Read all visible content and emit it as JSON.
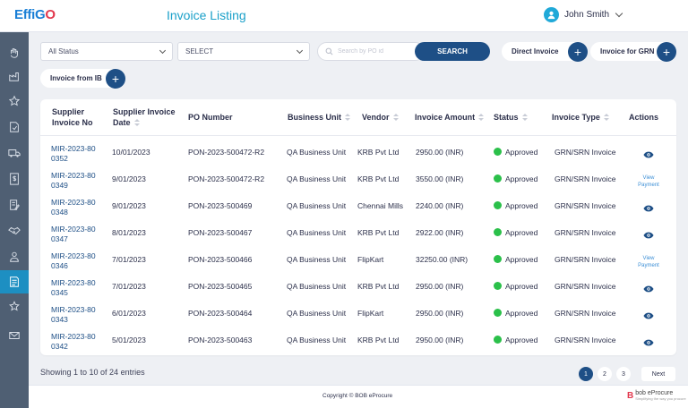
{
  "header": {
    "logo_main": "Effi",
    "logo_go": "G",
    "logo_o": "O",
    "title": "Invoice Listing",
    "user_name": "John Smith"
  },
  "sidebar": {
    "items": [
      {
        "icon": "hand-icon"
      },
      {
        "icon": "factory-icon"
      },
      {
        "icon": "star-icon"
      },
      {
        "icon": "document-check-icon"
      },
      {
        "icon": "truck-icon"
      },
      {
        "icon": "invoice-dollar-icon"
      },
      {
        "icon": "document-edit-icon"
      },
      {
        "icon": "handshake-icon"
      },
      {
        "icon": "user-badge-icon"
      },
      {
        "icon": "invoice-list-icon",
        "active": true
      },
      {
        "icon": "star-settings-icon"
      },
      {
        "icon": "mail-icon"
      }
    ]
  },
  "filters": {
    "status_value": "All Status",
    "select_value": "SELECT",
    "search_placeholder": "Search by PO id",
    "search_button": "SEARCH",
    "direct_invoice": "Direct Invoice",
    "invoice_for_grn": "Invoice for GRN",
    "invoice_from_ib": "Invoice from IB"
  },
  "table": {
    "headers": {
      "supplier_invoice_no_1": "Supplier",
      "supplier_invoice_no_2": "Invoice No",
      "supplier_invoice_date_1": "Supplier Invoice",
      "supplier_invoice_date_2": "Date",
      "po_number": "PO Number",
      "business_unit": "Business Unit",
      "vendor": "Vendor",
      "invoice_amount": "Invoice Amount",
      "status": "Status",
      "invoice_type": "Invoice Type",
      "actions": "Actions"
    },
    "rows": [
      {
        "inv1": "MIR-2023-80",
        "inv2": "0352",
        "date": "10/01/2023",
        "po": "PON-2023-500472-R2",
        "bu": "QA Business Unit",
        "vendor": "KRB Pvt Ltd",
        "amount": "2950.00 (INR)",
        "status": "Approved",
        "type": "GRN/SRN Invoice",
        "action": "view",
        "action_l1": "",
        "action_l2": ""
      },
      {
        "inv1": "MIR-2023-80",
        "inv2": "0349",
        "date": "9/01/2023",
        "po": "PON-2023-500472-R2",
        "bu": "QA Business Unit",
        "vendor": "KRB Pvt Ltd",
        "amount": "3550.00 (INR)",
        "status": "Approved",
        "type": "GRN/SRN Invoice",
        "action": "payment",
        "action_l1": "View",
        "action_l2": "Payment"
      },
      {
        "inv1": "MIR-2023-80",
        "inv2": "0348",
        "date": "9/01/2023",
        "po": "PON-2023-500469",
        "bu": "QA Business Unit",
        "vendor": "Chennai Mills",
        "amount": "2240.00 (INR)",
        "status": "Approved",
        "type": "GRN/SRN Invoice",
        "action": "view",
        "action_l1": "",
        "action_l2": ""
      },
      {
        "inv1": "MIR-2023-80",
        "inv2": "0347",
        "date": "8/01/2023",
        "po": "PON-2023-500467",
        "bu": "QA Business Unit",
        "vendor": "KRB Pvt Ltd",
        "amount": "2922.00 (INR)",
        "status": "Approved",
        "type": "GRN/SRN Invoice",
        "action": "view",
        "action_l1": "",
        "action_l2": ""
      },
      {
        "inv1": "MIR-2023-80",
        "inv2": "0346",
        "date": "7/01/2023",
        "po": "PON-2023-500466",
        "bu": "QA Business Unit",
        "vendor": "FlipKart",
        "amount": "32250.00 (INR)",
        "status": "Approved",
        "type": "GRN/SRN Invoice",
        "action": "payment",
        "action_l1": "View",
        "action_l2": "Payment"
      },
      {
        "inv1": "MIR-2023-80",
        "inv2": "0345",
        "date": "7/01/2023",
        "po": "PON-2023-500465",
        "bu": "QA Business Unit",
        "vendor": "KRB Pvt Ltd",
        "amount": "2950.00 (INR)",
        "status": "Approved",
        "type": "GRN/SRN Invoice",
        "action": "view",
        "action_l1": "",
        "action_l2": ""
      },
      {
        "inv1": "MIR-2023-80",
        "inv2": "0343",
        "date": "6/01/2023",
        "po": "PON-2023-500464",
        "bu": "QA Business Unit",
        "vendor": "FlipKart",
        "amount": "2950.00 (INR)",
        "status": "Approved",
        "type": "GRN/SRN Invoice",
        "action": "view",
        "action_l1": "",
        "action_l2": ""
      },
      {
        "inv1": "MIR-2023-80",
        "inv2": "0342",
        "date": "5/01/2023",
        "po": "PON-2023-500463",
        "bu": "QA Business Unit",
        "vendor": "KRB Pvt Ltd",
        "amount": "2950.00 (INR)",
        "status": "Approved",
        "type": "GRN/SRN Invoice",
        "action": "view",
        "action_l1": "",
        "action_l2": ""
      }
    ]
  },
  "pagination": {
    "summary": "Showing 1 to 10 of 24 entries",
    "pages": [
      "1",
      "2",
      "3"
    ],
    "current": "1",
    "next": "Next"
  },
  "footer": {
    "copyright": "Copyright © BOB eProcure",
    "brand": "bob eProcure",
    "brand_sub": "Simplifying the way you procure",
    "brand_mark": "B"
  },
  "colors": {
    "accent": "#1e4f86",
    "title": "#1aa0c9",
    "sidebar": "#4f5f73",
    "sidebar_active": "#1d8fc2",
    "approved": "#2bc04a"
  }
}
